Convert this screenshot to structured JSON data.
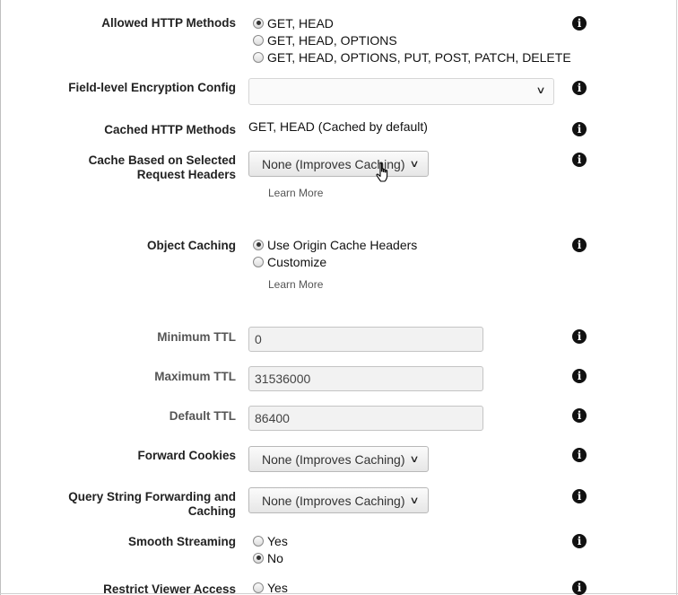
{
  "allowed_http_methods": {
    "label": "Allowed HTTP Methods",
    "options": [
      "GET, HEAD",
      "GET, HEAD, OPTIONS",
      "GET, HEAD, OPTIONS, PUT, POST, PATCH, DELETE"
    ],
    "selected_index": 0
  },
  "field_level_encryption": {
    "label": "Field-level Encryption Config",
    "value": ""
  },
  "cached_http_methods": {
    "label": "Cached HTTP Methods",
    "value": "GET, HEAD (Cached by default)"
  },
  "cache_based_on_headers": {
    "label_line1": "Cache Based on Selected",
    "label_line2": "Request Headers",
    "value": "None (Improves Caching)",
    "learn_more": "Learn More"
  },
  "object_caching": {
    "label": "Object Caching",
    "options": [
      "Use Origin Cache Headers",
      "Customize"
    ],
    "selected_index": 0,
    "learn_more": "Learn More"
  },
  "minimum_ttl": {
    "label": "Minimum TTL",
    "value": "0"
  },
  "maximum_ttl": {
    "label": "Maximum TTL",
    "value": "31536000"
  },
  "default_ttl": {
    "label": "Default TTL",
    "value": "86400"
  },
  "forward_cookies": {
    "label": "Forward Cookies",
    "value": "None (Improves Caching)"
  },
  "query_string_forwarding": {
    "label_line1": "Query String Forwarding and",
    "label_line2": "Caching",
    "value": "None (Improves Caching)"
  },
  "smooth_streaming": {
    "label": "Smooth Streaming",
    "options": [
      "Yes",
      "No"
    ],
    "selected_index": 1
  },
  "restrict_viewer_access": {
    "label": "Restrict Viewer Access",
    "options": [
      "Yes"
    ]
  },
  "icons": {
    "info": "info-icon",
    "chevron": "chevron-down-icon",
    "cursor": "hand-pointer-icon"
  }
}
